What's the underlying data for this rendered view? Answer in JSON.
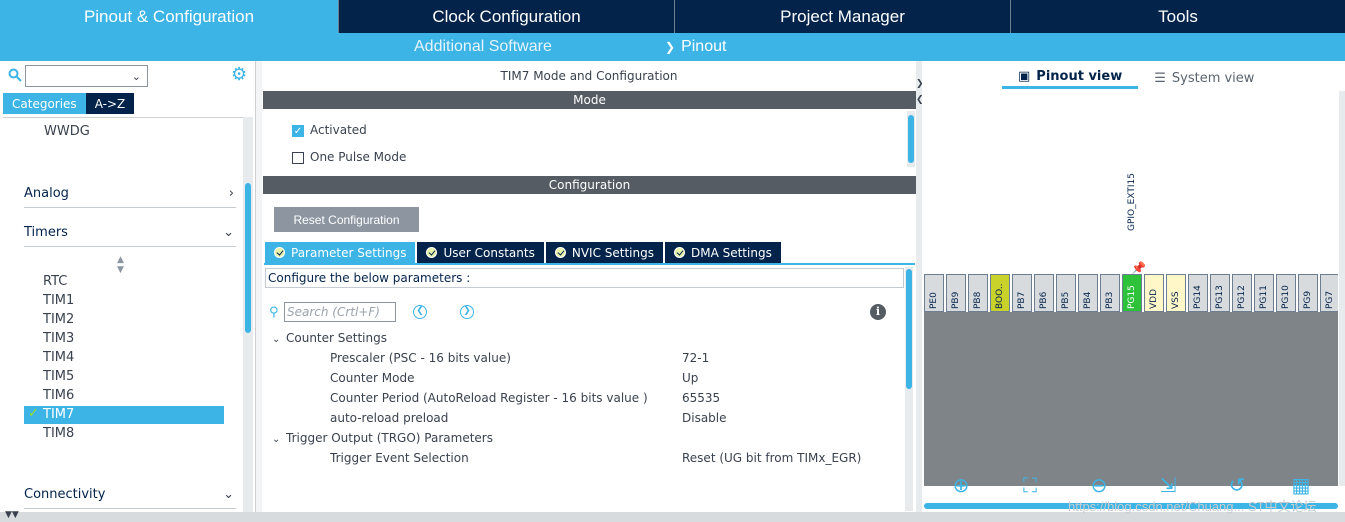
{
  "top_tabs": [
    {
      "label": "Pinout & Configuration",
      "active": true
    },
    {
      "label": "Clock Configuration",
      "active": false
    },
    {
      "label": "Project Manager",
      "active": false
    },
    {
      "label": "Tools",
      "active": false
    }
  ],
  "subbar": {
    "additional_software": "Additional Software",
    "pinout": "Pinout"
  },
  "left": {
    "category_tabs": [
      "Categories",
      "A->Z"
    ],
    "items": {
      "wwdg": "WWDG"
    },
    "groups": {
      "analog": "Analog",
      "timers": "Timers",
      "connectivity": "Connectivity"
    },
    "timers": [
      "RTC",
      "TIM1",
      "TIM2",
      "TIM3",
      "TIM4",
      "TIM5",
      "TIM6"
    ],
    "selected": "TIM7",
    "after_selected": "TIM8"
  },
  "mid": {
    "title": "TIM7 Mode and Configuration",
    "mode_band": "Mode",
    "activated": "Activated",
    "one_pulse": "One Pulse Mode",
    "config_band": "Configuration",
    "reset_button": "Reset Configuration",
    "param_tabs": [
      "Parameter Settings",
      "User Constants",
      "NVIC Settings",
      "DMA Settings"
    ],
    "configure_text": "Configure the below parameters :",
    "search_placeholder": "Search (Crtl+F)",
    "counter_section": "Counter Settings",
    "params": [
      {
        "name": "Prescaler (PSC - 16 bits value)",
        "value": "72-1"
      },
      {
        "name": "Counter Mode",
        "value": "Up"
      },
      {
        "name": "Counter Period (AutoReload Register - 16 bits value )",
        "value": "65535"
      },
      {
        "name": "auto-reload preload",
        "value": "Disable"
      }
    ],
    "trigger_section": "Trigger Output (TRGO) Parameters",
    "trigger_param": {
      "name": "Trigger Event Selection",
      "value": "Reset (UG bit from TIMx_EGR)"
    }
  },
  "right": {
    "pinout_view": "Pinout view",
    "system_view": "System view",
    "pins": [
      "PE0",
      "PB9",
      "PB8",
      "BOO..",
      "PB7",
      "PB6",
      "PB5",
      "PB4",
      "PB3",
      "PG15",
      "VDD",
      "VSS",
      "PG14",
      "PG13",
      "PG12",
      "PG11",
      "PG10",
      "PG9",
      "PG7"
    ],
    "gpio_label": "GPIO_EXTI15"
  },
  "watermark": "https://blog.csdn.net/Chuang... ST中文论坛"
}
